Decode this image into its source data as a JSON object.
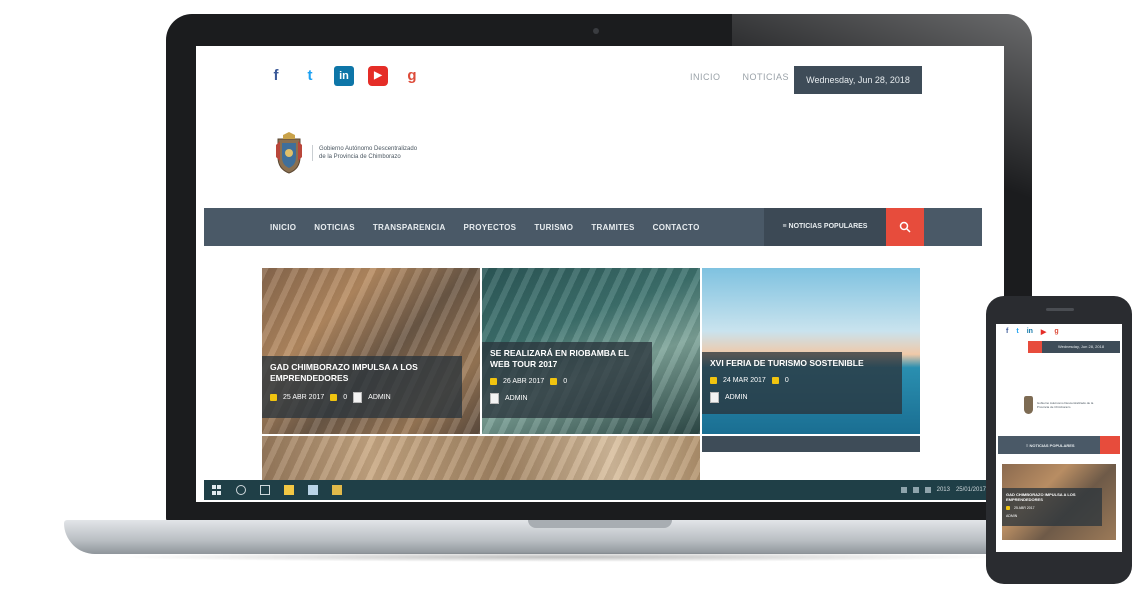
{
  "social": [
    "f",
    "t",
    "in",
    "▶",
    "g"
  ],
  "header": {
    "links": [
      "INICIO",
      "NOTICIAS"
    ],
    "date": "Wednesday, Jun 28, 2018"
  },
  "logo": {
    "text": "Gobierno Autónomo Descentralizado de la Provincia de Chimborazo"
  },
  "nav": {
    "items": [
      "INICIO",
      "NOTICIAS",
      "TRANSPARENCIA",
      "PROYECTOS",
      "TURISMO",
      "TRAMITES",
      "CONTACTO"
    ],
    "popular": "≡ NOTICIAS POPULARES"
  },
  "featured": [
    {
      "title": "GAD CHIMBORAZO IMPULSA A LOS EMPRENDEDORES",
      "date": "25 ABR 2017",
      "comments": "0",
      "author": "ADMIN"
    },
    {
      "title": "SE REALIZARÁ EN RIOBAMBA EL WEB TOUR 2017",
      "date": "26 ABR 2017",
      "comments": "0",
      "author": "ADMIN"
    },
    {
      "title": "XVI FERIA DE TURISMO SOSTENIBLE",
      "date": "24 MAR 2017",
      "comments": "0",
      "author": "ADMIN"
    }
  ],
  "taskbar": {
    "time": "2013",
    "date": "25/01/2017"
  },
  "phone": {
    "date": "Wednesday, Jun 28, 2018",
    "logo_text": "Gobierno Autónomo Descentralizado de la Provincia de Chimborazo",
    "nav_popular": "≡ NOTICIAS POPULARES",
    "featured_title": "GAD CHIMBORAZO IMPULSA A LOS EMPRENDEDORES",
    "featured_date": "25 ABR 2017",
    "featured_author": "ADMIN"
  },
  "colors": {
    "nav": "#4a5967",
    "accent": "#e74c3c",
    "date_box": "#3e4c58",
    "taskbar": "#1f3f47"
  }
}
